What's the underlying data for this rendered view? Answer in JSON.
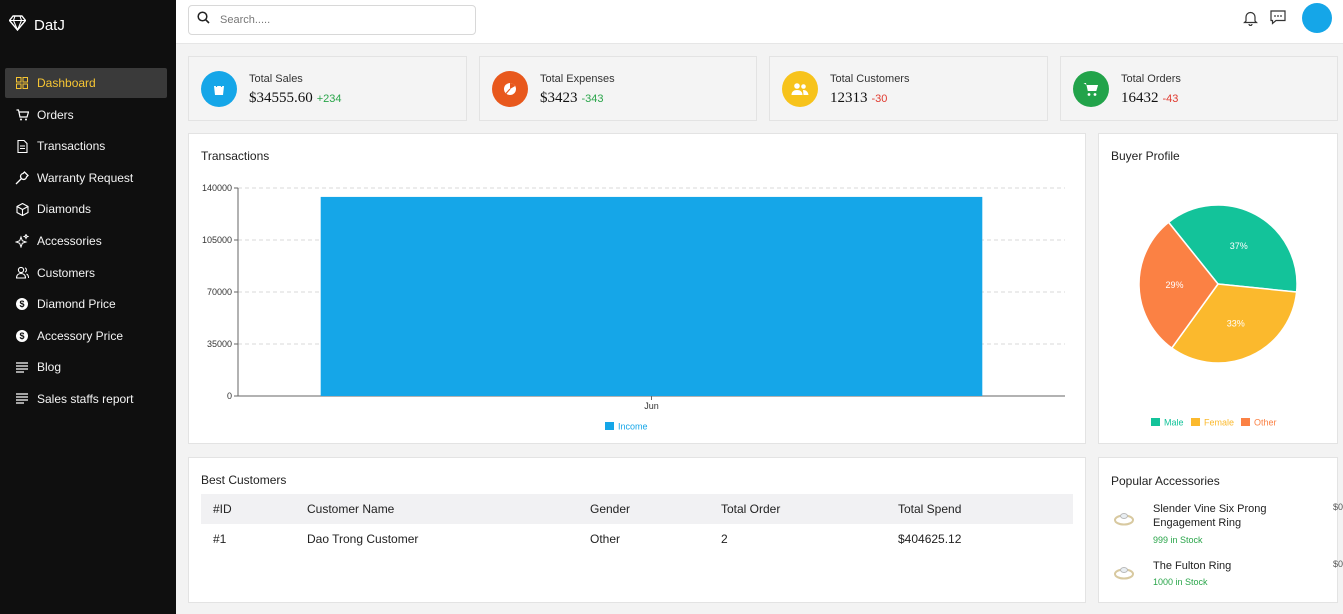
{
  "app": {
    "name": "DatJ"
  },
  "sidebar": {
    "items": [
      {
        "label": "Dashboard",
        "icon": "grid-icon",
        "active": true
      },
      {
        "label": "Orders",
        "icon": "cart-icon"
      },
      {
        "label": "Transactions",
        "icon": "document-icon"
      },
      {
        "label": "Warranty Request",
        "icon": "wrench-icon"
      },
      {
        "label": "Diamonds",
        "icon": "cube-icon"
      },
      {
        "label": "Accessories",
        "icon": "sparkle-icon"
      },
      {
        "label": "Customers",
        "icon": "users-icon"
      },
      {
        "label": "Diamond Price",
        "icon": "dollar-icon"
      },
      {
        "label": "Accessory Price",
        "icon": "dollar-icon"
      },
      {
        "label": "Blog",
        "icon": "lines-icon"
      },
      {
        "label": "Sales staffs report",
        "icon": "lines-icon"
      }
    ]
  },
  "header": {
    "search_placeholder": "Search....."
  },
  "stats": [
    {
      "label": "Total Sales",
      "value": "$34555.60",
      "delta": "+234",
      "positive": true,
      "color": "#15a6e8",
      "icon": "shopping-bag-icon"
    },
    {
      "label": "Total Expenses",
      "value": "$3423",
      "delta": "-343",
      "positive": true,
      "color": "#e8581c",
      "icon": "pie-chart-icon"
    },
    {
      "label": "Total Customers",
      "value": "12313",
      "delta": "-30",
      "positive": false,
      "color": "#f7c31b",
      "icon": "people-icon"
    },
    {
      "label": "Total Orders",
      "value": "16432",
      "delta": "-43",
      "positive": false,
      "color": "#22a34a",
      "icon": "cart-icon"
    }
  ],
  "transactions": {
    "title": "Transactions"
  },
  "buyer_profile": {
    "title": "Buyer Profile"
  },
  "chart_data": [
    {
      "type": "bar",
      "title": "Transactions",
      "categories": [
        "Jun"
      ],
      "series": [
        {
          "name": "Income",
          "values": [
            134000
          ],
          "color": "#15a6e8"
        }
      ],
      "ylim": [
        0,
        140000
      ],
      "yticks": [
        "0",
        "35000",
        "70000",
        "105000",
        "140000"
      ],
      "grid": true,
      "legend": "bottom"
    },
    {
      "type": "pie",
      "title": "Buyer Profile",
      "labels": [
        "Male",
        "Female",
        "Other"
      ],
      "values": [
        37,
        33,
        29
      ],
      "value_labels": [
        "37%",
        "33%",
        "29%"
      ],
      "colors": [
        "#13c39a",
        "#fbb92d",
        "#fb8144"
      ],
      "legend": "bottom"
    }
  ],
  "best_customers": {
    "title": "Best Customers",
    "columns": [
      "#ID",
      "Customer Name",
      "Gender",
      "Total Order",
      "Total Spend"
    ],
    "rows": [
      [
        "#1",
        "Dao Trong Customer",
        "Other",
        "2",
        "$404625.12"
      ]
    ]
  },
  "popular_accessories": {
    "title": "Popular Accessories",
    "items": [
      {
        "name": "Slender Vine Six Prong Engagement Ring",
        "stock": "999 in Stock",
        "price": "$0"
      },
      {
        "name": "The Fulton Ring",
        "stock": "1000 in Stock",
        "price": "$0"
      }
    ]
  }
}
